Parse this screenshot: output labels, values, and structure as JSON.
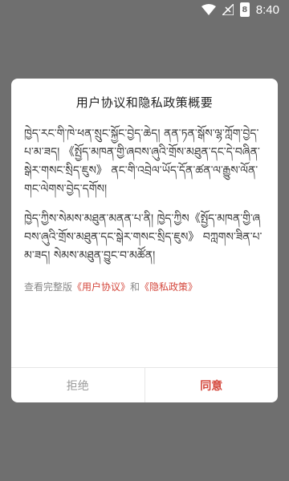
{
  "status_bar": {
    "time": "8:40",
    "battery_label": "8"
  },
  "dialog": {
    "title": "用户协议和隐私政策概要",
    "paragraph_1": "ཁྱེད་རང་གི་ཁེ་ཕན་སྲུང་སྐྱོང་བྱེད་ཆེད། ནན་ཏན་སྒོས་ལྷ་ཀློག་བྱེད་པ་མ་ཟད། 《སྤྱོད་མཁན་གྱི་ཞབས་ཞུའི་གྲོས་མཐུན་དང་དེ་བཞིན་སྒེར་གསང་སྲིད་ཇུས》 ནང་གི་འབྲེལ་ཡོད་དོན་ཚན་ལ་རྒྱུས་ལོན་གང་ལེགས་བྱེད་དགོས།",
    "paragraph_2": "ཁྱེད་ཀྱིས་སེམས་མཐུན་མནན་པ་ནི། ཁྱེད་ཀྱིས《སྤྱོད་མཁན་གྱི་ཞབས་ཞུའི་གྲོས་མཐུན་དང་སྒེར་གསང་སྲིད་ཇུས》 བཀླགས་ཟིན་པ་མ་ཟད། སེམས་མཐུན་བྱུང་བ་མཚོན།",
    "links_prefix": "查看完整版",
    "user_agreement_link": "《用户协议》",
    "links_and": "和",
    "privacy_policy_link": "《隐私政策》",
    "decline_label": "拒绝",
    "agree_label": "同意"
  },
  "colors": {
    "overlay": "#6f6f6f",
    "accent": "#d4463b"
  }
}
